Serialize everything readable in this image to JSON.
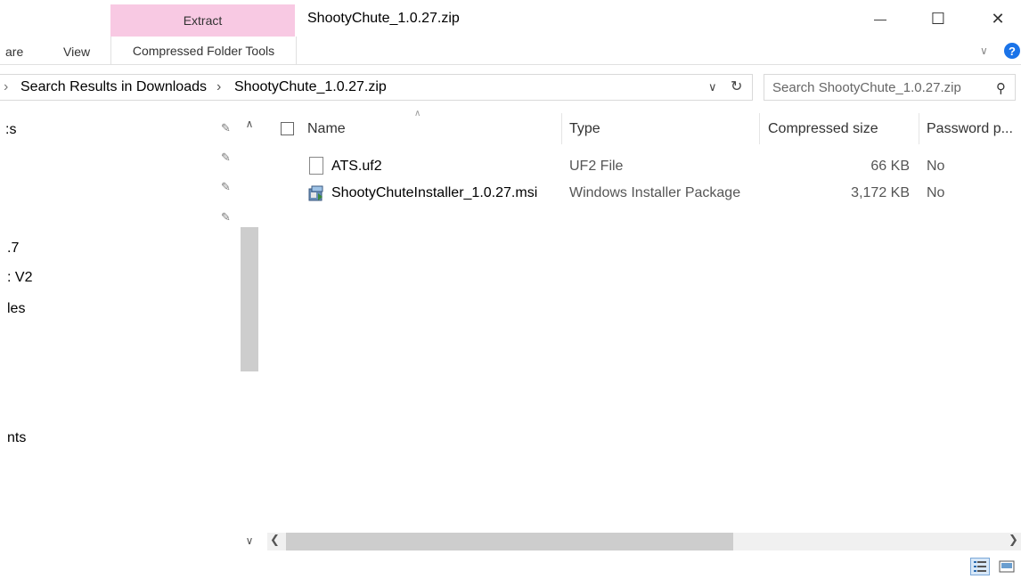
{
  "window": {
    "title": "ShootyChute_1.0.27.zip",
    "minimize_glyph": "—",
    "maximize_glyph": "☐",
    "close_glyph": "✕"
  },
  "ribbon": {
    "context_tab_top": "Extract",
    "context_tab_bottom": "Compressed Folder Tools",
    "tabs": [
      {
        "label": "are"
      },
      {
        "label": "View"
      }
    ],
    "help_glyph": "?"
  },
  "address_bar": {
    "prefix_glyph": "›",
    "crumbs": [
      "Search Results in Downloads",
      "ShootyChute_1.0.27.zip"
    ],
    "separator": "›"
  },
  "search": {
    "placeholder": "Search ShootyChute_1.0.27.zip"
  },
  "nav_pane": {
    "items": [
      {
        "label": ":s"
      },
      {
        "label": ".7"
      },
      {
        "label": ": V2"
      },
      {
        "label": "les"
      },
      {
        "label": "nts"
      }
    ]
  },
  "columns": {
    "name": "Name",
    "type": "Type",
    "compressed_size": "Compressed size",
    "password": "Password p..."
  },
  "files": [
    {
      "name": "ATS.uf2",
      "type": "UF2 File",
      "size": "66 KB",
      "password": "No",
      "icon": "document-icon"
    },
    {
      "name": "ShootyChuteInstaller_1.0.27.msi",
      "type": "Windows Installer Package",
      "size": "3,172 KB",
      "password": "No",
      "icon": "installer-icon"
    }
  ],
  "colors": {
    "context_tab": "#f8c9e3",
    "help": "#1a73e8",
    "scroll_thumb": "#cdcdcd"
  }
}
